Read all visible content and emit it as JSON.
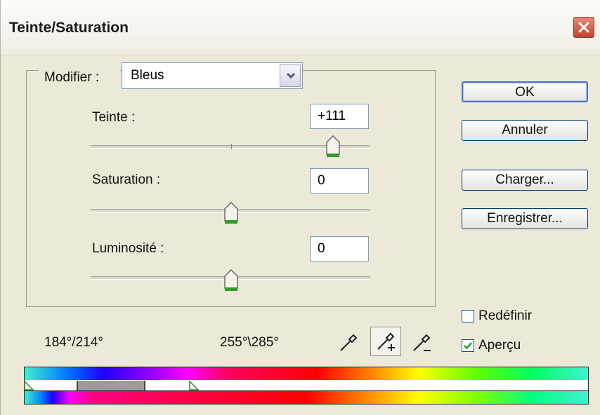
{
  "window": {
    "title": "Teinte/Saturation"
  },
  "modify": {
    "label": "Modifier :",
    "selected": "Bleus"
  },
  "hue": {
    "label": "Teinte :",
    "value": "+111"
  },
  "saturation": {
    "label": "Saturation :",
    "value": "0"
  },
  "lightness": {
    "label": "Luminosité :",
    "value": "0"
  },
  "buttons": {
    "ok": "OK",
    "cancel": "Annuler",
    "load": "Charger...",
    "save": "Enregistrer..."
  },
  "checkboxes": {
    "colorize": {
      "label": "Redéfinir",
      "checked": false
    },
    "preview": {
      "label": "Aperçu",
      "checked": true
    }
  },
  "ranges": {
    "left": "184°/214°",
    "right": "255°\\285°"
  },
  "icons": [
    "close-icon",
    "chevron-down-icon",
    "eyedropper-icon",
    "eyedropper-plus-icon",
    "eyedropper-minus-icon",
    "check-icon"
  ],
  "colors": {
    "accent": "#003c74",
    "close": "#c3422d",
    "thumb_green": "#2f9d2f"
  }
}
